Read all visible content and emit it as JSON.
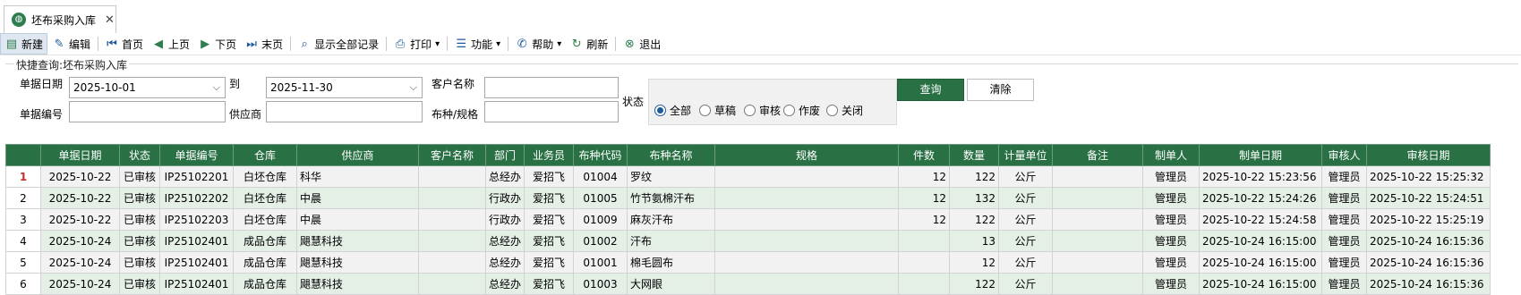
{
  "tab": {
    "title": "坯布采购入库",
    "close": "✕"
  },
  "toolbar": [
    {
      "name": "new-button",
      "label": "新建",
      "icon": "▤",
      "cls": "green",
      "active": true
    },
    {
      "name": "edit-button",
      "label": "编辑",
      "icon": "✎",
      "cls": "blue"
    },
    {
      "sep": true
    },
    {
      "name": "first-page-button",
      "label": "首页",
      "icon": "⏮",
      "cls": "blue"
    },
    {
      "name": "prev-page-button",
      "label": "上页",
      "icon": "◀",
      "cls": "green"
    },
    {
      "name": "next-page-button",
      "label": "下页",
      "icon": "▶",
      "cls": "green"
    },
    {
      "name": "last-page-button",
      "label": "末页",
      "icon": "⏭",
      "cls": "blue"
    },
    {
      "sep": true
    },
    {
      "name": "show-all-button",
      "label": "显示全部记录",
      "icon": "⌕",
      "cls": "blue"
    },
    {
      "sep": true
    },
    {
      "name": "print-button",
      "label": "打印",
      "icon": "⎙",
      "cls": "blue",
      "dropdown": true
    },
    {
      "sep": true
    },
    {
      "name": "function-button",
      "label": "功能",
      "icon": "☰",
      "cls": "blue",
      "dropdown": true
    },
    {
      "sep": true
    },
    {
      "name": "help-button",
      "label": "帮助",
      "icon": "✆",
      "cls": "blue",
      "dropdown": true
    },
    {
      "name": "refresh-button",
      "label": "刷新",
      "icon": "↻",
      "cls": "green"
    },
    {
      "sep": true
    },
    {
      "name": "exit-button",
      "label": "退出",
      "icon": "⊗",
      "cls": "green"
    }
  ],
  "query": {
    "legend": "快捷查询:坯布采购入库",
    "date_label": "单据日期",
    "date_from": "2025-10-01",
    "to_label": "到",
    "date_to": "2025-11-30",
    "customer_label": "客户名称",
    "customer_value": "",
    "status_label": "状态",
    "docno_label": "单据编号",
    "docno_value": "",
    "supplier_label": "供应商",
    "supplier_value": "",
    "fabric_label": "布种/规格",
    "fabric_value": "",
    "status_options": [
      "全部",
      "草稿",
      "审核",
      "作废",
      "关闭"
    ],
    "status_selected": "全部",
    "query_button": "查询",
    "clear_button": "清除"
  },
  "table": {
    "columns": [
      "",
      "单据日期",
      "状态",
      "单据编号",
      "仓库",
      "供应商",
      "客户名称",
      "部门",
      "业务员",
      "布种代码",
      "布种名称",
      "规格",
      "件数",
      "数量",
      "计量单位",
      "备注",
      "制单人",
      "制单日期",
      "审核人",
      "审核日期"
    ],
    "rows": [
      [
        "1",
        "2025-10-22",
        "已审核",
        "IP25102201",
        "白坯仓库",
        "科华",
        "",
        "总经办",
        "爱招飞",
        "01004",
        "罗纹",
        "",
        "12",
        "122",
        "公斤",
        "",
        "管理员",
        "2025-10-22 15:23:56",
        "管理员",
        "2025-10-22 15:25:32"
      ],
      [
        "2",
        "2025-10-22",
        "已审核",
        "IP25102202",
        "白坯仓库",
        "中晨",
        "",
        "行政办",
        "爱招飞",
        "01005",
        "竹节氨棉汗布",
        "",
        "12",
        "132",
        "公斤",
        "",
        "管理员",
        "2025-10-22 15:24:26",
        "管理员",
        "2025-10-22 15:24:51"
      ],
      [
        "3",
        "2025-10-22",
        "已审核",
        "IP25102203",
        "白坯仓库",
        "中晨",
        "",
        "行政办",
        "爱招飞",
        "01009",
        "麻灰汗布",
        "",
        "12",
        "122",
        "公斤",
        "",
        "管理员",
        "2025-10-22 15:24:58",
        "管理员",
        "2025-10-22 15:25:19"
      ],
      [
        "4",
        "2025-10-24",
        "已审核",
        "IP25102401",
        "成品仓库",
        "飓慧科技",
        "",
        "总经办",
        "爱招飞",
        "01002",
        "汗布",
        "",
        "",
        "13",
        "公斤",
        "",
        "管理员",
        "2025-10-24 16:15:00",
        "管理员",
        "2025-10-24 16:15:36"
      ],
      [
        "5",
        "2025-10-24",
        "已审核",
        "IP25102401",
        "成品仓库",
        "飓慧科技",
        "",
        "总经办",
        "爱招飞",
        "01001",
        "棉毛圆布",
        "",
        "",
        "12",
        "公斤",
        "",
        "管理员",
        "2025-10-24 16:15:00",
        "管理员",
        "2025-10-24 16:15:36"
      ],
      [
        "6",
        "2025-10-24",
        "已审核",
        "IP25102401",
        "成品仓库",
        "飓慧科技",
        "",
        "总经办",
        "爱招飞",
        "01003",
        "大网眼",
        "",
        "",
        "122",
        "公斤",
        "",
        "管理员",
        "2025-10-24 16:15:00",
        "管理员",
        "2025-10-24 16:15:36"
      ]
    ]
  }
}
